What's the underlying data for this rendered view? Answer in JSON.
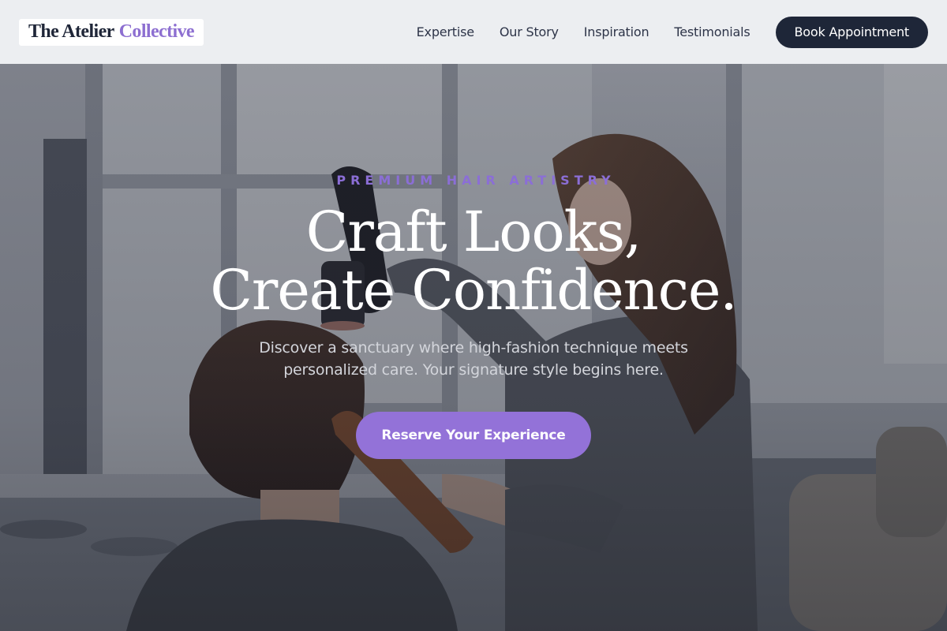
{
  "brand": {
    "name_part1": "The Atelier",
    "name_part2": "Collective"
  },
  "nav": {
    "items": [
      {
        "label": "Expertise"
      },
      {
        "label": "Our Story"
      },
      {
        "label": "Inspiration"
      },
      {
        "label": "Testimonials"
      }
    ],
    "cta_label": "Book Appointment"
  },
  "hero": {
    "eyebrow": "PREMIUM HAIR ARTISTRY",
    "headline_line1": "Craft Looks,",
    "headline_line2": "Create Confidence.",
    "subtext": "Discover a sanctuary where high-fashion technique meets personalized care. Your signature style begins here.",
    "cta_label": "Reserve Your Experience"
  },
  "colors": {
    "accent": "#9372d8",
    "brand_dark": "#1e2638",
    "header_bg": "#eceef1"
  }
}
